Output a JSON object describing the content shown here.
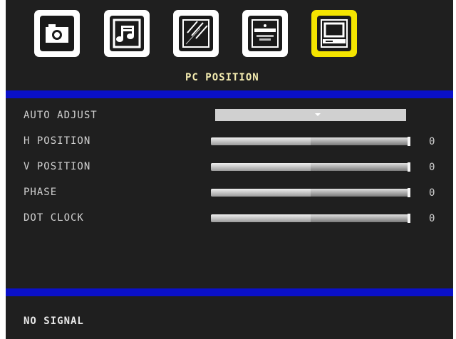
{
  "menu": {
    "icons": [
      {
        "name": "picture-icon",
        "selected": false
      },
      {
        "name": "sound-icon",
        "selected": false
      },
      {
        "name": "feature-icon",
        "selected": false
      },
      {
        "name": "install-icon",
        "selected": false
      },
      {
        "name": "pc-icon",
        "selected": true
      }
    ],
    "title": "PC POSITION"
  },
  "settings": {
    "auto_adjust_label": "AUTO ADJUST",
    "rows": [
      {
        "label": "H POSITION",
        "value": "0",
        "level": 0.5
      },
      {
        "label": "V POSITION",
        "value": "0",
        "level": 0.5
      },
      {
        "label": "PHASE",
        "value": "0",
        "level": 0.5
      },
      {
        "label": "DOT CLOCK",
        "value": "0",
        "level": 0.5
      }
    ]
  },
  "status": "NO SIGNAL",
  "colors": {
    "accent_band": "#0a10c8",
    "selected_tab": "#f4e400",
    "background": "#1f1f1f"
  }
}
